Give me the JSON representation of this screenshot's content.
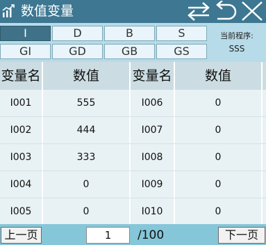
{
  "header": {
    "title": "数值变量",
    "icons": {
      "app": "bar-chart-icon",
      "switch": "swap-arrows-icon",
      "back": "back-arrow-icon",
      "close": "close-icon"
    }
  },
  "type_tabs": {
    "row1": [
      "I",
      "D",
      "B",
      "S"
    ],
    "row2": [
      "GI",
      "GD",
      "GB",
      "GS"
    ],
    "active": "I"
  },
  "program": {
    "label": "当前程序:",
    "name": "SSS"
  },
  "table": {
    "headers": [
      "变量名",
      "数值",
      "变量名",
      "数值"
    ],
    "rows": [
      {
        "name1": "I001",
        "value1": "555",
        "name2": "I006",
        "value2": "0"
      },
      {
        "name1": "I002",
        "value1": "444",
        "name2": "I007",
        "value2": "0"
      },
      {
        "name1": "I003",
        "value1": "333",
        "name2": "I008",
        "value2": "0"
      },
      {
        "name1": "I004",
        "value1": "0",
        "name2": "I009",
        "value2": "0"
      },
      {
        "name1": "I005",
        "value1": "0",
        "name2": "I010",
        "value2": "0"
      }
    ]
  },
  "pager": {
    "prev": "上一页",
    "next": "下一页",
    "page": "1",
    "total": "/100"
  },
  "colors": {
    "titlebar": "#3d7791",
    "active_tab": "#3f7288",
    "pager_bg": "#86c6d9"
  }
}
